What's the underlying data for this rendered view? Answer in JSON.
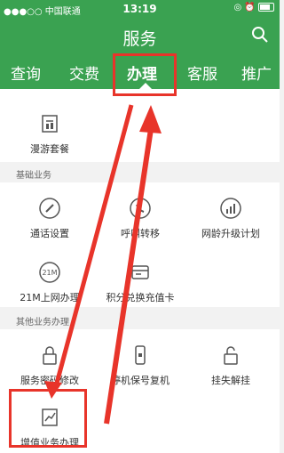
{
  "status": {
    "carrier": "●●●○○ 中国联通",
    "time": "13:19",
    "right": "◎ ⏰"
  },
  "header": {
    "title": "服务",
    "search_icon": "search-icon"
  },
  "tabs": [
    {
      "label": "查询",
      "active": false
    },
    {
      "label": "交费",
      "active": false
    },
    {
      "label": "办理",
      "active": true
    },
    {
      "label": "客服",
      "active": false
    },
    {
      "label": "推广",
      "active": false
    }
  ],
  "top_item": {
    "label": "漫游套餐",
    "icon": "roaming-package-icon"
  },
  "sections": [
    {
      "title": "基础业务",
      "rows": [
        [
          {
            "label": "通话设置",
            "icon": "pen-icon"
          },
          {
            "label": "呼叫转移",
            "icon": "call-forward-icon"
          },
          {
            "label": "网龄升级计划",
            "icon": "signal-bars-icon"
          }
        ],
        [
          {
            "label": "21M上网办理",
            "icon": "21m-icon"
          },
          {
            "label": "积分兑换充值卡",
            "icon": "card-exchange-icon"
          }
        ]
      ]
    },
    {
      "title": "其他业务办理",
      "rows": [
        [
          {
            "label": "服务密码修改",
            "icon": "lock-icon"
          },
          {
            "label": "停机保号复机",
            "icon": "phone-lock-icon"
          },
          {
            "label": "挂失解挂",
            "icon": "unlock-icon"
          }
        ],
        [
          {
            "label": "增值业务办理",
            "icon": "value-added-chart-icon"
          }
        ]
      ]
    }
  ],
  "colors": {
    "brand_green": "#3aa251",
    "annotation_red": "#e8342a"
  }
}
